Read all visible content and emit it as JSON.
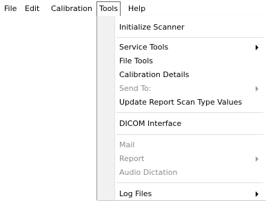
{
  "menubar": {
    "items": [
      "File",
      "Edit",
      "Calibration",
      "Tools",
      "Help"
    ]
  },
  "tools_menu": {
    "items": [
      {
        "label": "Initialize Scanner",
        "enabled": true,
        "submenu": false
      },
      {
        "label": "Service Tools",
        "enabled": true,
        "submenu": true
      },
      {
        "label": "File Tools",
        "enabled": true,
        "submenu": false
      },
      {
        "label": "Calibration Details",
        "enabled": true,
        "submenu": false
      },
      {
        "label": "Send To:",
        "enabled": false,
        "submenu": true
      },
      {
        "label": "Update Report Scan Type Values",
        "enabled": true,
        "submenu": false
      },
      {
        "label": "DICOM Interface",
        "enabled": true,
        "submenu": false
      },
      {
        "label": "Mail",
        "enabled": false,
        "submenu": false
      },
      {
        "label": "Report",
        "enabled": false,
        "submenu": true
      },
      {
        "label": "Audio Dictation",
        "enabled": false,
        "submenu": false
      },
      {
        "label": "Log Files",
        "enabled": true,
        "submenu": true
      }
    ]
  }
}
